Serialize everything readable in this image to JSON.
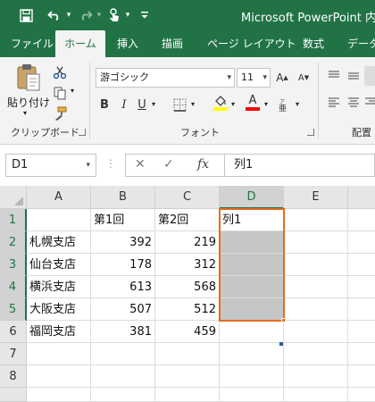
{
  "title_bar": {
    "title": "Microsoft PowerPoint 内の",
    "qat_icons": [
      "save-icon",
      "undo-icon",
      "redo-icon",
      "touch-mode-icon",
      "customize-icon"
    ]
  },
  "tabs": [
    {
      "label": "ファイル"
    },
    {
      "label": "ホーム"
    },
    {
      "label": "挿入"
    },
    {
      "label": "描画"
    },
    {
      "label": "ページ レイアウト"
    },
    {
      "label": "数式"
    },
    {
      "label": "データ"
    }
  ],
  "ribbon": {
    "clipboard": {
      "paste_label": "貼り付け",
      "group_label": "クリップボード"
    },
    "font": {
      "font_name": "游ゴシック",
      "font_size": "11",
      "bold": "B",
      "italic": "I",
      "underline": "U",
      "group_label": "フォント",
      "fill_color": "#ffff00",
      "font_color": "#ff0000"
    },
    "alignment": {
      "group_label": "配置"
    }
  },
  "formula_bar": {
    "name_box": "D1",
    "fx_label": "fx",
    "formula": "列1"
  },
  "sheet": {
    "columns": [
      "A",
      "B",
      "C",
      "D",
      "E"
    ],
    "rows": [
      "1",
      "2",
      "3",
      "4",
      "5",
      "6",
      "7",
      "8"
    ],
    "cells": {
      "B1": "第1回",
      "C1": "第2回",
      "D1": "列1",
      "A2": "札幌支店",
      "B2": "392",
      "C2": "219",
      "A3": "仙台支店",
      "B3": "178",
      "C3": "312",
      "A4": "横浜支店",
      "B4": "613",
      "C4": "568",
      "A5": "大阪支店",
      "B5": "507",
      "C5": "512",
      "A6": "福岡支店",
      "B6": "381",
      "C6": "459"
    },
    "selected_column": "D",
    "selected_rows": [
      "1",
      "2",
      "3",
      "4",
      "5"
    ],
    "selection_range": "D1:D5",
    "active_cell": "D1"
  },
  "colors": {
    "excel_green": "#217346",
    "selection_orange": "#e56b1f"
  }
}
